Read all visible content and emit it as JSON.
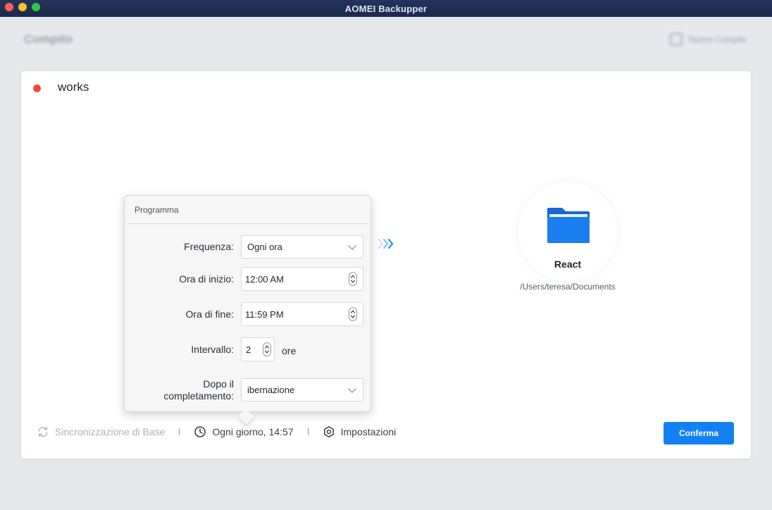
{
  "window": {
    "title": "AOMEI Backupper"
  },
  "background": {
    "page_title": "Compito",
    "new_task_label": "Nuovo Compito"
  },
  "task": {
    "name": "works",
    "status_color": "#f2483a"
  },
  "destination": {
    "name": "React",
    "path": "/Users/teresa/Documents",
    "icon": "folder-icon"
  },
  "bottom_bar": {
    "sync_mode_label": "Sincronizzazione di Base",
    "schedule_label": "Ogni giorno, 14:57",
    "settings_label": "Impostazioni",
    "confirm_label": "Conferma"
  },
  "schedule_popover": {
    "title": "Programma",
    "frequency": {
      "label": "Frequenza:",
      "value": "Ogni ora"
    },
    "start_time": {
      "label": "Ora di inizio:",
      "value": "12:00 AM"
    },
    "end_time": {
      "label": "Ora di fine:",
      "value": "11:59 PM"
    },
    "interval": {
      "label": "Intervallo:",
      "value": "2",
      "unit": "ore"
    },
    "after_completion": {
      "label_line1": "Dopo il",
      "label_line2": "completamento:",
      "value": "ibernazione"
    }
  },
  "colors": {
    "accent": "#1480f5",
    "titlebar": "#1f2e52",
    "folder": "#1a73e8"
  }
}
